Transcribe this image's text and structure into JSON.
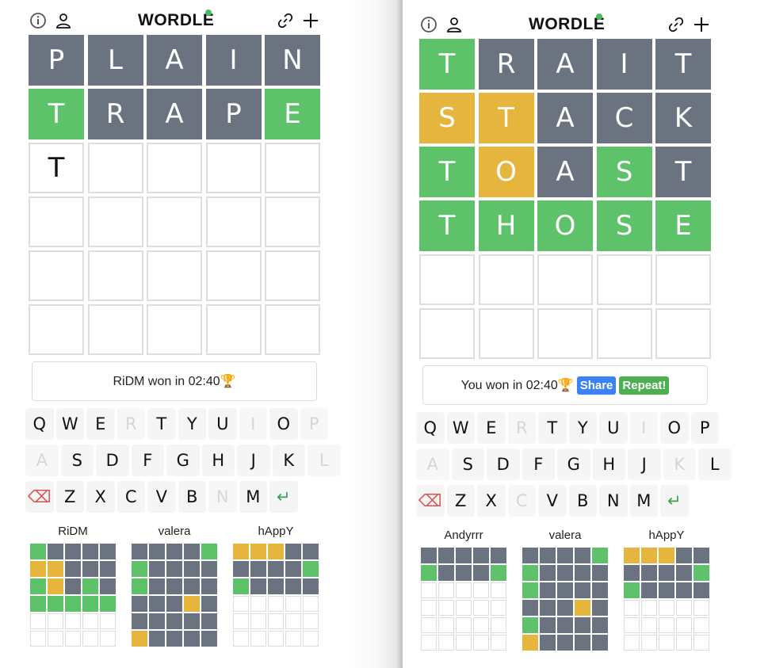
{
  "colors": {
    "green": "#5ec26a",
    "yellow": "#e5b53d",
    "gray": "#6b7280",
    "empty_border": "#dedede",
    "share": "#3b82f6",
    "repeat": "#4caf50"
  },
  "panels": [
    {
      "header": {
        "title": "WORDLE",
        "icons": [
          "info-icon",
          "user-icon",
          "link-icon",
          "plus-icon"
        ]
      },
      "board": {
        "letters": [
          [
            "P",
            "L",
            "A",
            "I",
            "N"
          ],
          [
            "T",
            "R",
            "A",
            "P",
            "E"
          ],
          [
            "T",
            "",
            "",
            "",
            "",
            ""
          ],
          [
            "",
            "",
            "",
            "",
            ""
          ],
          [
            "",
            "",
            "",
            "",
            ""
          ],
          [
            "",
            "",
            "",
            "",
            ""
          ]
        ],
        "states": [
          "xxxxx",
          "gxxxg",
          "teeee",
          "eeeee",
          "eeeee",
          "eeeee"
        ]
      },
      "status": {
        "text": "RiDM won in 02:40🏆",
        "share_label": "",
        "repeat_label": ""
      },
      "keyboard": {
        "rows": [
          [
            "Q",
            "W",
            "E",
            "R",
            "T",
            "Y",
            "U",
            "I",
            "O",
            "P"
          ],
          [
            "A",
            "S",
            "D",
            "F",
            "G",
            "H",
            "J",
            "K",
            "L"
          ],
          [
            "⌫",
            "Z",
            "X",
            "C",
            "V",
            "B",
            "N",
            "M",
            "↵"
          ]
        ],
        "disabled": [
          [
            "R",
            "I",
            "P"
          ],
          [
            "A",
            "L"
          ],
          [
            "N"
          ]
        ]
      },
      "players": [
        {
          "name": "RiDM",
          "grid": [
            "gxxxx",
            "yyxxx",
            "gyxgx",
            "ggggg",
            "eeeee",
            "eeeee"
          ]
        },
        {
          "name": "valera",
          "grid": [
            "xxxxg",
            "gxxxx",
            "gxxxx",
            "xxxyx",
            "xxxxx",
            "yxxxx"
          ]
        },
        {
          "name": "hAppY",
          "grid": [
            "yyyxx",
            "xxxxg",
            "gxxxx",
            "eeeee",
            "eeeee",
            "eeeee"
          ]
        }
      ]
    },
    {
      "header": {
        "title": "WORDLE",
        "icons": [
          "info-icon",
          "user-icon",
          "link-icon",
          "plus-icon"
        ]
      },
      "board": {
        "letters": [
          [
            "T",
            "R",
            "A",
            "I",
            "T"
          ],
          [
            "S",
            "T",
            "A",
            "C",
            "K"
          ],
          [
            "T",
            "O",
            "A",
            "S",
            "T"
          ],
          [
            "T",
            "H",
            "O",
            "S",
            "E"
          ],
          [
            "",
            "",
            "",
            "",
            ""
          ],
          [
            "",
            "",
            "",
            "",
            ""
          ]
        ],
        "states": [
          "gxxxx",
          "yyxxx",
          "gyxgx",
          "ggggg",
          "eeeee",
          "eeeee"
        ]
      },
      "status": {
        "text": "You won in 02:40🏆",
        "share_label": "Share",
        "repeat_label": "Repeat!"
      },
      "keyboard": {
        "rows": [
          [
            "Q",
            "W",
            "E",
            "R",
            "T",
            "Y",
            "U",
            "I",
            "O",
            "P"
          ],
          [
            "A",
            "S",
            "D",
            "F",
            "G",
            "H",
            "J",
            "K",
            "L"
          ],
          [
            "⌫",
            "Z",
            "X",
            "C",
            "V",
            "B",
            "N",
            "M",
            "↵"
          ]
        ],
        "disabled": [
          [
            "R",
            "I"
          ],
          [
            "A",
            "K"
          ],
          [
            "C"
          ]
        ]
      },
      "players": [
        {
          "name": "Andyrrr",
          "grid": [
            "xxxxx",
            "gxxxg",
            "eeeee",
            "eeeee",
            "eeeee",
            "eeeee"
          ]
        },
        {
          "name": "valera",
          "grid": [
            "xxxxg",
            "gxxxx",
            "gxxxx",
            "xxxyx",
            "gxxxx",
            "yxxxx"
          ]
        },
        {
          "name": "hAppY",
          "grid": [
            "yyyxx",
            "xxxxg",
            "gxxxx",
            "eeeee",
            "eeeee",
            "eeeee"
          ]
        }
      ]
    }
  ]
}
